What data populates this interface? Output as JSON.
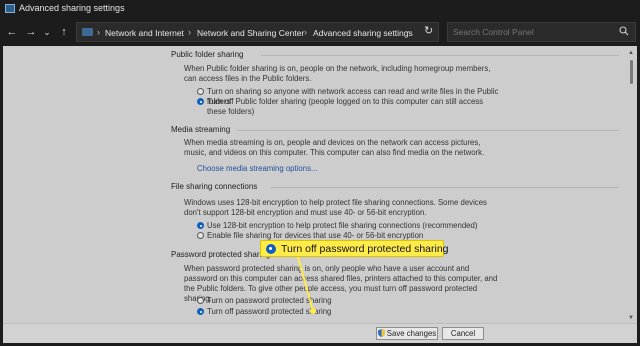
{
  "window": {
    "title": "Advanced sharing settings"
  },
  "nav": {
    "back": "←",
    "forward": "→",
    "dropdown": "⌄",
    "up": "↑",
    "breadcrumb": [
      "Network and Internet",
      "Network and Sharing Center",
      "Advanced sharing settings"
    ],
    "separator": "›",
    "address_dropdown": "⌄",
    "refresh": "↻",
    "search_placeholder": "Search Control Panel"
  },
  "sections": {
    "public_folder": {
      "title": "Public folder sharing",
      "desc": "When Public folder sharing is on, people on the network, including homegroup members, can access files in the Public folders.",
      "options": [
        {
          "label": "Turn on sharing so anyone with network access can read and write files in the Public folders",
          "checked": false
        },
        {
          "label": "Turn off Public folder sharing (people logged on to this computer can still access these folders)",
          "checked": true
        }
      ]
    },
    "media": {
      "title": "Media streaming",
      "desc": "When media streaming is on, people and devices on the network can access pictures, music, and videos on this computer. This computer can also find media on the network.",
      "link": "Choose media streaming options..."
    },
    "file_sharing": {
      "title": "File sharing connections",
      "desc": "Windows uses 128-bit encryption to help protect file sharing connections. Some devices don't support 128-bit encryption and must use 40- or 56-bit encryption.",
      "options": [
        {
          "label": "Use 128-bit encryption to help protect file sharing connections (recommended)",
          "checked": true
        },
        {
          "label": "Enable file sharing for devices that use 40- or 56-bit encryption",
          "checked": false
        }
      ]
    },
    "password": {
      "title": "Password protected sharing",
      "desc": "When password protected sharing is on, only people who have a user account and password on this computer can access shared files, printers attached to this computer, and the Public folders. To give other people access, you must turn off password protected sharing.",
      "options": [
        {
          "label": "Turn on password protected sharing",
          "checked": false
        },
        {
          "label": "Turn off password protected sharing",
          "checked": true
        }
      ]
    }
  },
  "callout": {
    "label": "Turn off password protected sharing",
    "color": "#ffeb4a"
  },
  "buttons": {
    "save": "Save changes",
    "cancel": "Cancel"
  },
  "colors": {
    "accent": "#0f5fbd",
    "link": "#1f4f9a",
    "highlight": "#ffeb4a"
  }
}
